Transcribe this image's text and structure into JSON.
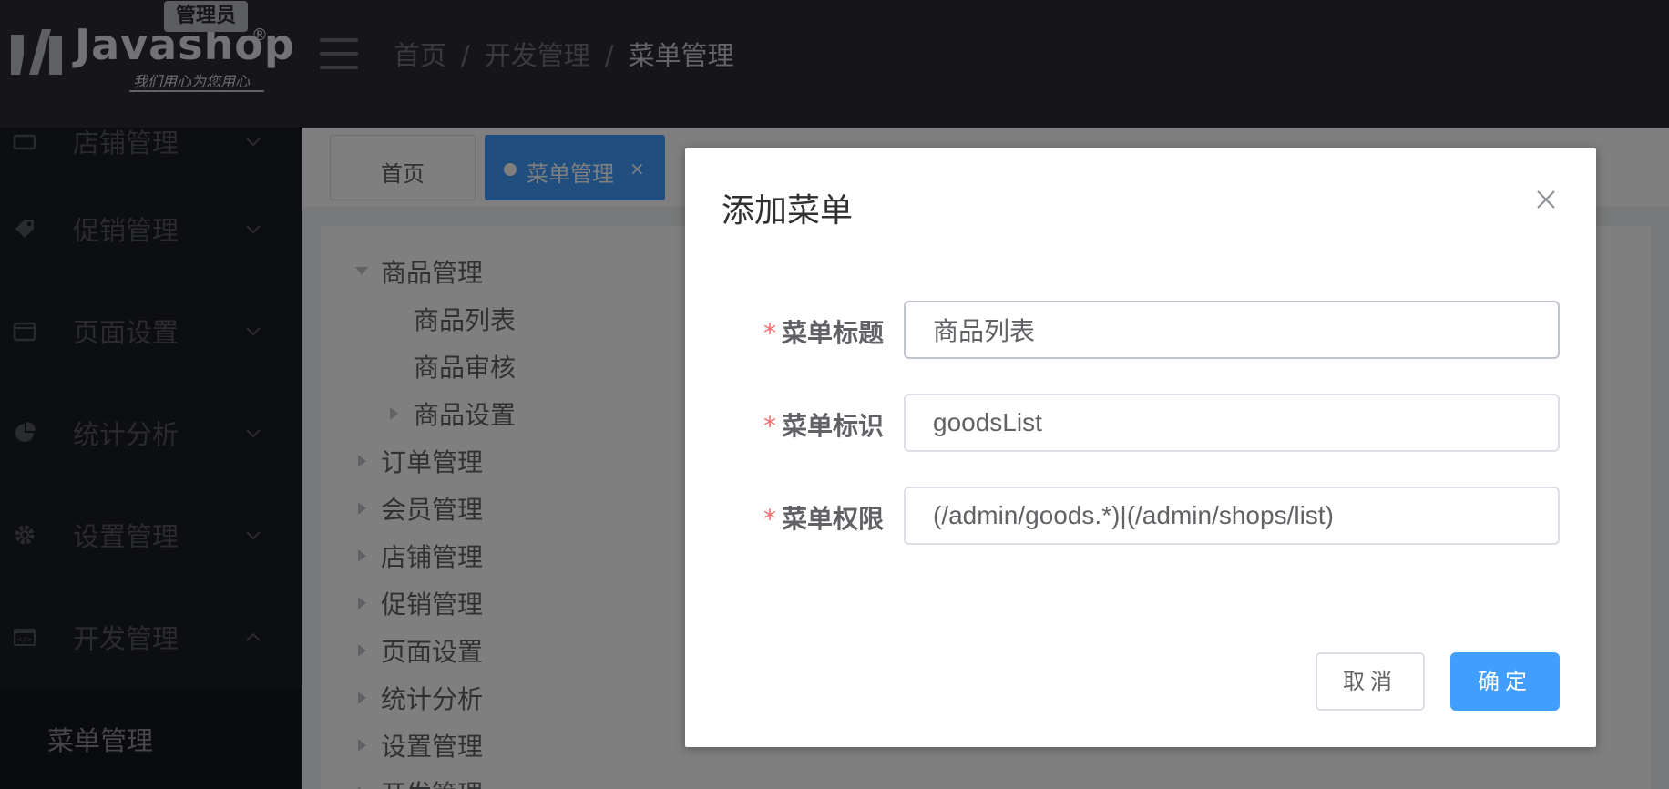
{
  "header": {
    "role_badge": "管理员",
    "logo_text": "Javashop",
    "logo_reg": "®",
    "logo_slogan": "我们用心为您用心",
    "breadcrumb": [
      "首页",
      "开发管理",
      "菜单管理"
    ],
    "separator": "/"
  },
  "sidebar": {
    "items": [
      {
        "label": "店铺管理",
        "icon": "shop-icon"
      },
      {
        "label": "促销管理",
        "icon": "tag-icon"
      },
      {
        "label": "页面设置",
        "icon": "page-icon"
      },
      {
        "label": "统计分析",
        "icon": "pie-chart-icon"
      },
      {
        "label": "设置管理",
        "icon": "gear-icon"
      },
      {
        "label": "开发管理",
        "icon": "code-icon"
      }
    ],
    "submenu_active": "菜单管理"
  },
  "tabs": {
    "home": "首页",
    "active": "菜单管理",
    "close": "×"
  },
  "tree": {
    "nodes": [
      {
        "label": "商品管理",
        "expanded": true,
        "level": 0
      },
      {
        "label": "商品列表",
        "level": 1
      },
      {
        "label": "商品审核",
        "level": 1
      },
      {
        "label": "商品设置",
        "level": 1,
        "has_children": true
      },
      {
        "label": "订单管理",
        "level": 0
      },
      {
        "label": "会员管理",
        "level": 0
      },
      {
        "label": "店铺管理",
        "level": 0
      },
      {
        "label": "促销管理",
        "level": 0
      },
      {
        "label": "页面设置",
        "level": 0
      },
      {
        "label": "统计分析",
        "level": 0
      },
      {
        "label": "设置管理",
        "level": 0
      },
      {
        "label": "开发管理",
        "level": 0
      }
    ]
  },
  "dialog": {
    "title": "添加菜单",
    "required_mark": "*",
    "fields": [
      {
        "label": "菜单标题",
        "value": "商品列表"
      },
      {
        "label": "菜单标识",
        "value": "goodsList"
      },
      {
        "label": "菜单权限",
        "value": "(/admin/goods.*)|(/admin/shops/list)"
      }
    ],
    "cancel_label": "取消",
    "ok_label": "确定"
  },
  "colors": {
    "header_bg": "#2a2b35",
    "sidebar_bg": "#1b1c24",
    "primary": "#409eff",
    "required": "#f56c6c"
  }
}
